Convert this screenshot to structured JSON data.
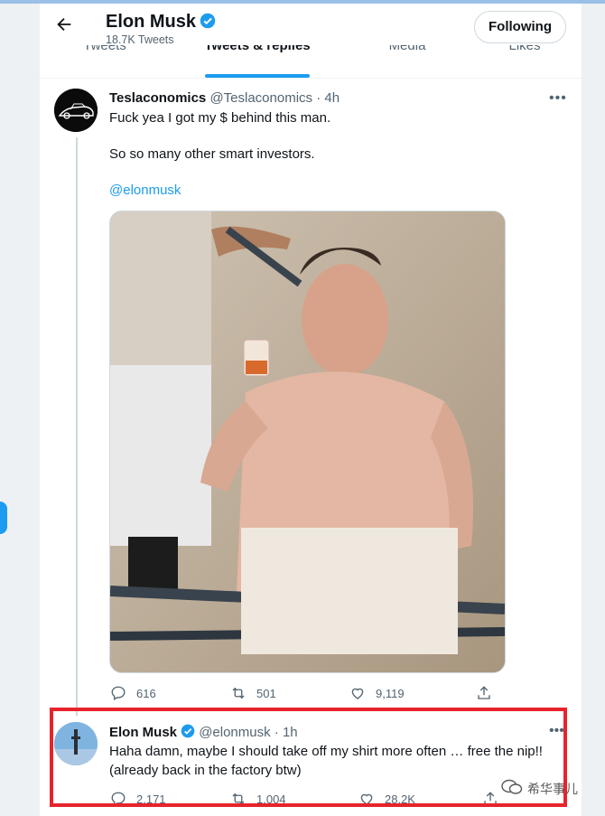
{
  "header": {
    "back_icon": "arrow-left-icon",
    "name": "Elon Musk",
    "tweet_count": "18.7K Tweets",
    "follow_label": "Following"
  },
  "tabs": [
    {
      "label": "Tweets"
    },
    {
      "label": "Tweets & replies",
      "active": true
    },
    {
      "label": "Media"
    },
    {
      "label": "Likes"
    }
  ],
  "tweet1": {
    "display_name": "Teslaconomics",
    "meta": "@Teslaconomics · 4h",
    "lines": [
      "Fuck yea I got my $ behind this man.",
      "So so many other smart investors.",
      "@elonmusk"
    ],
    "replies": "616",
    "retweets": "501",
    "likes": "9,119"
  },
  "tweet2": {
    "display_name": "Elon Musk",
    "meta": "@elonmusk · 1h",
    "text_line1": "Haha damn, maybe I should take off my shirt more often … free the nip!!",
    "text_line2": "(already back in the factory btw)",
    "replies": "2,171",
    "retweets": "1,004",
    "likes": "28.2K"
  },
  "watermark": "希华事儿",
  "colors": {
    "accent": "#1d9bf0",
    "highlight_border": "#e8232b",
    "text_secondary": "#536471"
  }
}
